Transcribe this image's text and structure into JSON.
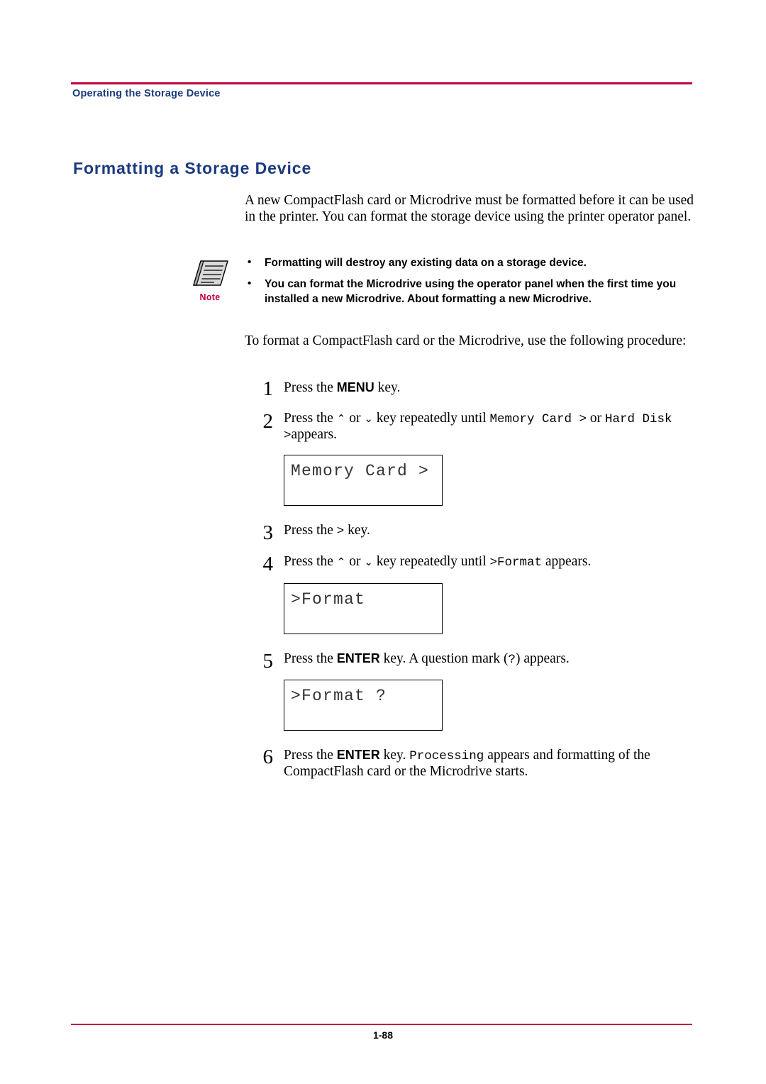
{
  "header": {
    "running_head": "Operating the Storage Device"
  },
  "title": "Formatting a Storage Device",
  "intro": "A new CompactFlash card or Microdrive must be formatted before it can be used in the printer. You can format the storage device using the printer operator panel.",
  "note": {
    "icon_label": "Note",
    "items": [
      "Formatting will destroy any existing data on a storage device.",
      "You can format the Microdrive using the operator panel when the first time you installed a new Microdrive. About formatting a new Microdrive."
    ]
  },
  "after_note": "To format a CompactFlash card or the Microdrive, use the following procedure:",
  "steps": [
    {
      "num": "1",
      "parts": [
        {
          "t": "Press the ",
          "s": "serif"
        },
        {
          "t": "MENU",
          "s": "bold"
        },
        {
          "t": " key.",
          "s": "serif"
        }
      ]
    },
    {
      "num": "2",
      "parts": [
        {
          "t": "Press the ",
          "s": "serif"
        },
        {
          "t": "⌃",
          "s": "glyph"
        },
        {
          "t": " or ",
          "s": "serif"
        },
        {
          "t": "⌄",
          "s": "glyph"
        },
        {
          "t": " key repeatedly until ",
          "s": "serif"
        },
        {
          "t": "Memory Card >",
          "s": "mono"
        },
        {
          "t": " or ",
          "s": "serif"
        },
        {
          "t": "Hard Disk >",
          "s": "mono"
        },
        {
          "t": "appears.",
          "s": "serif"
        }
      ]
    },
    {
      "num": "3",
      "parts": [
        {
          "t": "Press the ",
          "s": "serif"
        },
        {
          "t": ">",
          "s": "mono"
        },
        {
          "t": " key.",
          "s": "serif"
        }
      ]
    },
    {
      "num": "4",
      "parts": [
        {
          "t": "Press the ",
          "s": "serif"
        },
        {
          "t": "⌃",
          "s": "glyph"
        },
        {
          "t": " or ",
          "s": "serif"
        },
        {
          "t": "⌄",
          "s": "glyph"
        },
        {
          "t": " key repeatedly until ",
          "s": "serif"
        },
        {
          "t": ">Format",
          "s": "mono"
        },
        {
          "t": " appears.",
          "s": "serif"
        }
      ]
    },
    {
      "num": "5",
      "parts": [
        {
          "t": "Press the ",
          "s": "serif"
        },
        {
          "t": "ENTER",
          "s": "bold"
        },
        {
          "t": " key. A question mark (",
          "s": "serif"
        },
        {
          "t": "?",
          "s": "mono"
        },
        {
          "t": ") appears.",
          "s": "serif"
        }
      ]
    },
    {
      "num": "6",
      "parts": [
        {
          "t": "Press the ",
          "s": "serif"
        },
        {
          "t": "ENTER",
          "s": "bold"
        },
        {
          "t": " key. ",
          "s": "serif"
        },
        {
          "t": "Processing",
          "s": "mono"
        },
        {
          "t": " appears and formatting of the CompactFlash card or the Microdrive starts.",
          "s": "serif"
        }
      ]
    }
  ],
  "lcd_panels": [
    {
      "text": "Memory Card  >"
    },
    {
      "text": ">Format"
    },
    {
      "text": ">Format ?"
    }
  ],
  "footer": {
    "page_number": "1-88"
  },
  "colors": {
    "accent_rule": "#c0003c",
    "heading_blue": "#1b3a80",
    "note_label": "#c0003c"
  }
}
